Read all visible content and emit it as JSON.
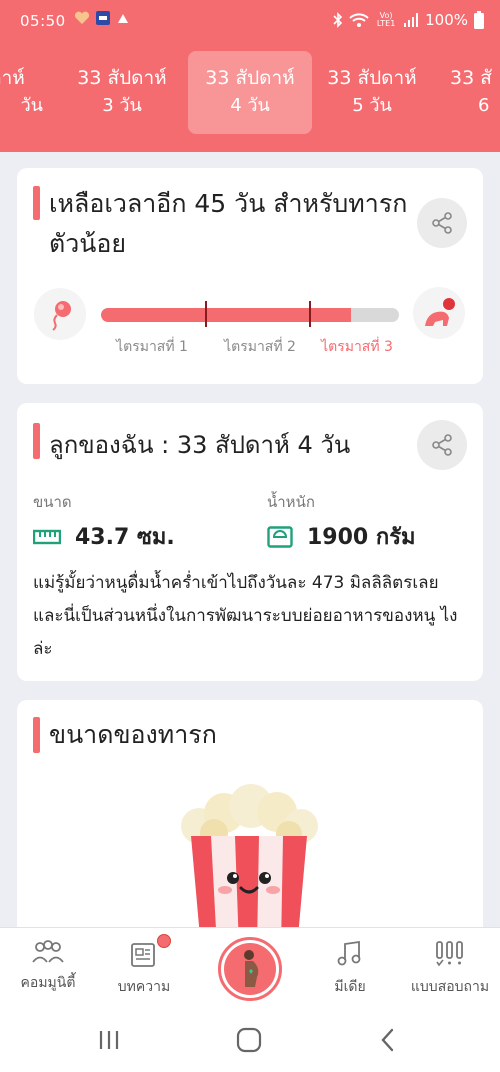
{
  "status": {
    "time": "05:50",
    "battery": "100%",
    "lte": "Vo) LTE1"
  },
  "week_tabs": [
    {
      "week": "ปดาห์",
      "day": "วัน"
    },
    {
      "week": "33 สัปดาห์",
      "day": "3 วัน"
    },
    {
      "week": "33 สัปดาห์",
      "day": "4 วัน"
    },
    {
      "week": "33 สัปดาห์",
      "day": "5 วัน"
    },
    {
      "week": "33 สั",
      "day": "6"
    }
  ],
  "countdown": {
    "title": "เหลือเวลาอีก 45 วัน สำหรับทารกตัวน้อย",
    "trimesters": [
      "ไตรมาสที่ 1",
      "ไตรมาสที่ 2",
      "ไตรมาสที่ 3"
    ],
    "progress": 0.84
  },
  "baby": {
    "title": "ลูกของฉัน : 33 สัปดาห์ 4  วัน",
    "size_label": "ขนาด",
    "size_value": "43.7 ซม.",
    "weight_label": "น้ำหนัก",
    "weight_value": "1900 กรัม",
    "fact": "แม่รู้มั้ยว่าหนูดื่มน้ำคร่ำเข้าไปถึงวันละ 473 มิลลิลิตรเลย และนี่เป็นส่วนหนึ่งในการพัฒนาระบบย่อยอาหารของหนู ไงล่ะ"
  },
  "size_card": {
    "title": "ขนาดของทารก"
  },
  "bottom_nav": {
    "community": "คอมมูนิตี้",
    "articles": "บทความ",
    "media": "มีเดีย",
    "quiz": "แบบสอบถาม"
  },
  "colors": {
    "accent": "#f56c70",
    "background": "#eceef3"
  },
  "icons": [
    "heart-icon",
    "news-icon",
    "bluetooth-icon",
    "wifi-icon",
    "signal-icon",
    "battery-icon",
    "share-icon",
    "sperm-icon",
    "crawling-baby-icon",
    "ruler-icon",
    "scale-icon",
    "popcorn-illustration",
    "community-icon",
    "article-icon",
    "pregnant-icon",
    "music-icon",
    "quiz-icon"
  ]
}
